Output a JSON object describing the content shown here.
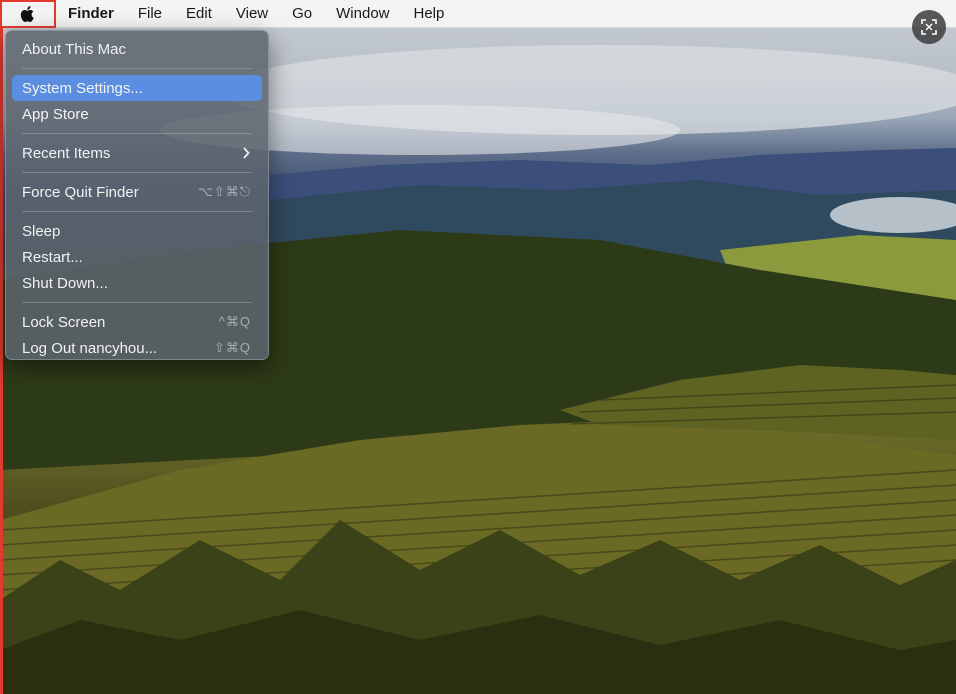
{
  "menubar": {
    "apple_icon": "apple-logo-icon",
    "items": [
      "Finder",
      "File",
      "Edit",
      "View",
      "Go",
      "Window",
      "Help"
    ]
  },
  "apple_menu": {
    "about": "About This Mac",
    "system_settings": "System Settings...",
    "app_store": "App Store",
    "recent_items": "Recent Items",
    "force_quit": "Force Quit Finder",
    "force_quit_shortcut": "⌥⇧⌘⎋",
    "sleep": "Sleep",
    "restart": "Restart...",
    "shut_down": "Shut Down...",
    "lock_screen": "Lock Screen",
    "lock_screen_shortcut": "^⌘Q",
    "log_out": "Log Out nancyhou...",
    "log_out_shortcut": "⇧⌘Q"
  },
  "colors": {
    "highlight": "#5b8de0",
    "focus_outline": "#e23a2e"
  }
}
